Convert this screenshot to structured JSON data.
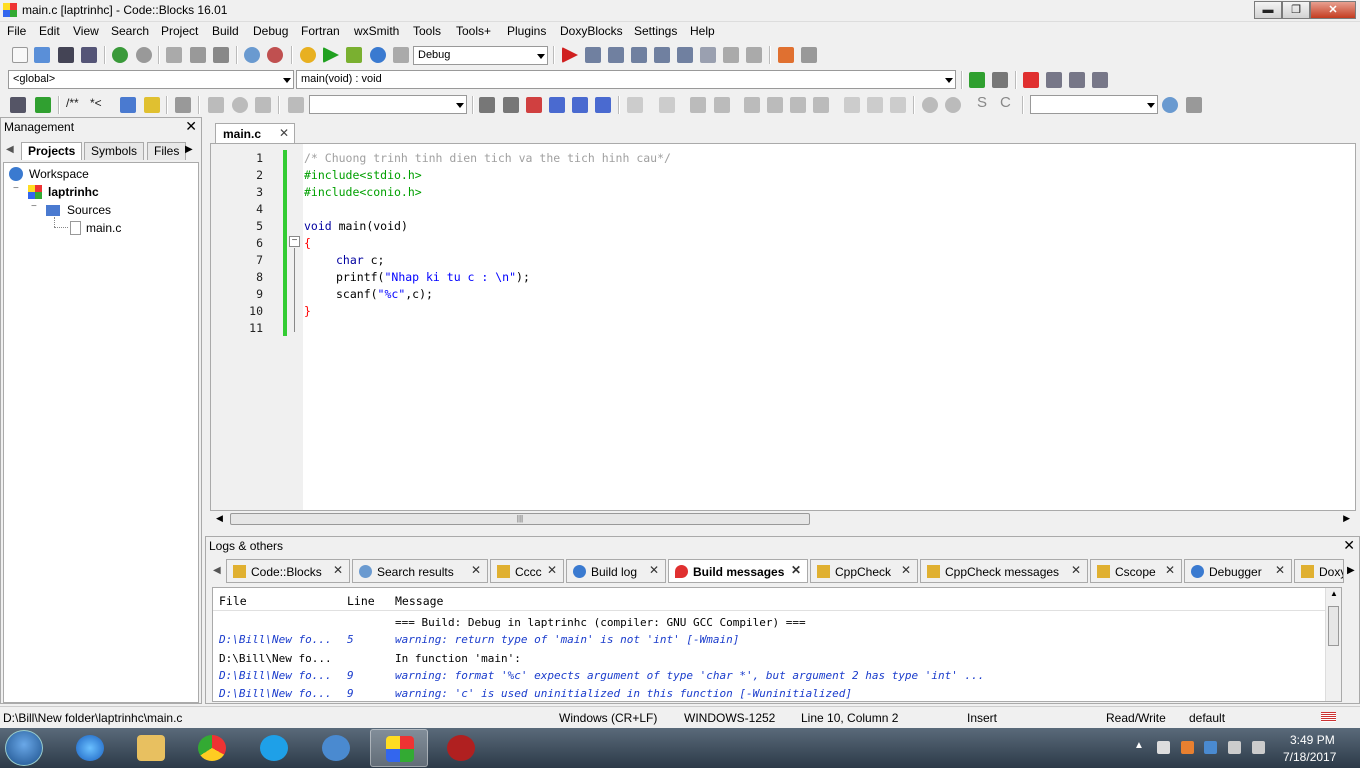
{
  "window": {
    "title": "main.c [laptrinhc] - Code::Blocks 16.01",
    "min_glyph": "▬",
    "max_glyph": "❐",
    "close_glyph": "✕"
  },
  "menu": [
    "File",
    "Edit",
    "View",
    "Search",
    "Project",
    "Build",
    "Debug",
    "Fortran",
    "wxSmith",
    "Tools",
    "Tools+",
    "Plugins",
    "DoxyBlocks",
    "Settings",
    "Help"
  ],
  "toolbar": {
    "build_target": "Debug",
    "scope": "<global>",
    "function": "main(void) : void",
    "comment_block": "/**",
    "comment_line": "*<",
    "search_s": "S",
    "search_c": "C"
  },
  "management": {
    "title": "Management",
    "close_glyph": "✕",
    "tabs": [
      "Projects",
      "Symbols",
      "Files"
    ],
    "tree": {
      "workspace": "Workspace",
      "project": "laptrinhc",
      "folder": "Sources",
      "file": "main.c",
      "expander_minus": "−"
    }
  },
  "editor": {
    "tab_label": "main.c",
    "tab_close": "✕",
    "fold_glyph": "−",
    "scroll_grip": "|||",
    "line_numbers": [
      "1",
      "2",
      "3",
      "4",
      "5",
      "6",
      "7",
      "8",
      "9",
      "10",
      "11"
    ],
    "code": {
      "l1": "/* Chuong trinh tinh dien tich va the tich hinh cau*/",
      "l2": "#include<stdio.h>",
      "l3": "#include<conio.h>",
      "l5_kw": "void",
      "l5_rest": " main(void)",
      "l6": "{",
      "l7_kw": "char",
      "l7_rest": " c;",
      "l8_a": "printf(",
      "l8_str": "\"Nhap ki tu c : \\n\"",
      "l8_b": ");",
      "l9_a": "scanf(",
      "l9_str": "\"%c\"",
      "l9_b": ",c);",
      "l10": "}"
    }
  },
  "logs": {
    "title": "Logs & others",
    "close_glyph": "✕",
    "tab_close": "✕",
    "tabs": [
      "Code::Blocks",
      "Search results",
      "Cccc",
      "Build log",
      "Build messages",
      "CppCheck",
      "CppCheck messages",
      "Cscope",
      "Debugger",
      "Doxy"
    ],
    "columns": [
      "File",
      "Line",
      "Message"
    ],
    "rows": [
      {
        "file": "",
        "line": "",
        "message": "=== Build: Debug in laptrinhc (compiler: GNU GCC Compiler) ==="
      },
      {
        "file": "D:\\Bill\\New fo...",
        "line": "5",
        "message": "warning: return type of 'main' is not 'int' [-Wmain]"
      },
      {
        "file": "D:\\Bill\\New fo...",
        "line": "",
        "message": "In function 'main':"
      },
      {
        "file": "D:\\Bill\\New fo...",
        "line": "9",
        "message": "warning: format '%c' expects argument of type 'char *', but argument 2 has type 'int' ..."
      },
      {
        "file": "D:\\Bill\\New fo...",
        "line": "9",
        "message": "warning: 'c' is used uninitialized in this function [-Wuninitialized]"
      }
    ]
  },
  "status": {
    "path": "D:\\Bill\\New folder\\laptrinhc\\main.c",
    "eol": "Windows (CR+LF)",
    "encoding": "WINDOWS-1252",
    "position": "Line 10, Column 2",
    "mode": "Insert",
    "access": "Read/Write",
    "profile": "default"
  },
  "taskbar": {
    "time": "3:49 PM",
    "date": "7/18/2017",
    "tray_arrow": "▲"
  },
  "colors": {
    "change_bar": "#33cc33",
    "keyword": "#0000a0",
    "preprocessor": "#00a000",
    "string": "#0000ff",
    "comment": "#a0a0a0",
    "warning": "#1a3ccc"
  }
}
